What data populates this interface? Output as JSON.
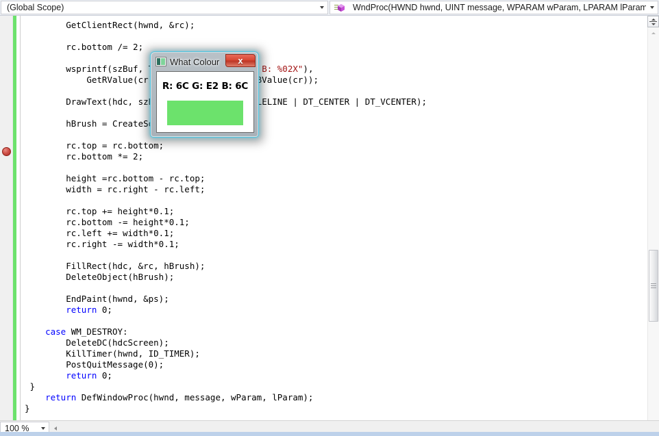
{
  "nav": {
    "scope": {
      "value": "(Global Scope)",
      "arrow_icon": "chevron-down-icon"
    },
    "member": {
      "value": "WndProc(HWND hwnd, UINT message, WPARAM wParam, LPARAM lParam)",
      "icon": "method-icon",
      "arrow_icon": "chevron-down-icon"
    }
  },
  "editor": {
    "gutter": {
      "breakpoint_icon": "breakpoint-icon",
      "change_bar_color": "#6ce26c"
    },
    "code_lines": [
      {
        "indent": 8,
        "tokens": [
          {
            "t": "GetClientRect(hwnd, &rc);",
            "c": "plain"
          }
        ]
      },
      {
        "indent": 0,
        "tokens": []
      },
      {
        "indent": 8,
        "tokens": [
          {
            "t": "rc.bottom /= 2;",
            "c": "plain"
          }
        ]
      },
      {
        "indent": 0,
        "tokens": []
      },
      {
        "indent": 8,
        "tokens": [
          {
            "t": "wsprintf(szBuf, TEXT(\"R: %02X G: %02X B: %02X\"),",
            "c": "mixed-string"
          }
        ]
      },
      {
        "indent": 12,
        "tokens": [
          {
            "t": "GetRValue(cr), GetGValue(cr), GetBValue(cr));",
            "c": "plain"
          }
        ]
      },
      {
        "indent": 0,
        "tokens": []
      },
      {
        "indent": 8,
        "tokens": [
          {
            "t": "DrawText(hdc, szBuf, -1, &rc, DT_SINGLELINE | DT_CENTER | DT_VCENTER);",
            "c": "plain"
          }
        ]
      },
      {
        "indent": 0,
        "tokens": []
      },
      {
        "indent": 8,
        "tokens": [
          {
            "t": "hBrush = CreateSolidBrush(cr);",
            "c": "plain"
          }
        ]
      },
      {
        "indent": 0,
        "tokens": []
      },
      {
        "indent": 8,
        "tokens": [
          {
            "t": "rc.top = rc.bottom;",
            "c": "plain"
          }
        ]
      },
      {
        "indent": 8,
        "tokens": [
          {
            "t": "rc.bottom *= 2;",
            "c": "plain"
          }
        ]
      },
      {
        "indent": 0,
        "tokens": []
      },
      {
        "indent": 8,
        "tokens": [
          {
            "t": "height =rc.bottom - rc.top;",
            "c": "plain"
          }
        ]
      },
      {
        "indent": 8,
        "tokens": [
          {
            "t": "width = rc.right - rc.left;",
            "c": "plain"
          }
        ]
      },
      {
        "indent": 0,
        "tokens": []
      },
      {
        "indent": 8,
        "tokens": [
          {
            "t": "rc.top += height*0.1;",
            "c": "plain"
          }
        ]
      },
      {
        "indent": 8,
        "tokens": [
          {
            "t": "rc.bottom -= height*0.1;",
            "c": "plain"
          }
        ]
      },
      {
        "indent": 8,
        "tokens": [
          {
            "t": "rc.left += width*0.1;",
            "c": "plain"
          }
        ]
      },
      {
        "indent": 8,
        "tokens": [
          {
            "t": "rc.right -= width*0.1;",
            "c": "plain"
          }
        ]
      },
      {
        "indent": 0,
        "tokens": []
      },
      {
        "indent": 8,
        "tokens": [
          {
            "t": "FillRect(hdc, &rc, hBrush);",
            "c": "plain"
          }
        ]
      },
      {
        "indent": 8,
        "tokens": [
          {
            "t": "DeleteObject(hBrush);",
            "c": "plain"
          }
        ]
      },
      {
        "indent": 0,
        "tokens": []
      },
      {
        "indent": 8,
        "tokens": [
          {
            "t": "EndPaint(hwnd, &ps);",
            "c": "plain"
          }
        ]
      },
      {
        "indent": 8,
        "tokens": [
          {
            "t": "return",
            "c": "kw"
          },
          {
            "t": " 0;",
            "c": "plain"
          }
        ]
      },
      {
        "indent": 0,
        "tokens": []
      },
      {
        "indent": 4,
        "tokens": [
          {
            "t": "case",
            "c": "kw"
          },
          {
            "t": " WM_DESTROY:",
            "c": "plain"
          }
        ]
      },
      {
        "indent": 8,
        "tokens": [
          {
            "t": "DeleteDC(hdcScreen);",
            "c": "plain"
          }
        ]
      },
      {
        "indent": 8,
        "tokens": [
          {
            "t": "KillTimer(hwnd, ID_TIMER);",
            "c": "plain"
          }
        ]
      },
      {
        "indent": 8,
        "tokens": [
          {
            "t": "PostQuitMessage(0);",
            "c": "plain"
          }
        ]
      },
      {
        "indent": 8,
        "tokens": [
          {
            "t": "return",
            "c": "kw"
          },
          {
            "t": " 0;",
            "c": "plain"
          }
        ]
      },
      {
        "indent": 1,
        "tokens": [
          {
            "t": "}",
            "c": "plain"
          }
        ]
      },
      {
        "indent": 4,
        "tokens": [
          {
            "t": "return",
            "c": "kw"
          },
          {
            "t": " DefWindowProc(hwnd, message, wParam, lParam);",
            "c": "plain"
          }
        ]
      },
      {
        "indent": 0,
        "tokens": [
          {
            "t": "}",
            "c": "plain"
          }
        ]
      }
    ],
    "overlapped_line_fragments": {
      "line5_right": "%02X B: %02X\"),",
      "line6_right": "tBValue(cr));",
      "line8_right": "_SINGLELINE | DT_CENTER | DT_VCENTER);",
      "line5_left": "wsprintf(szBuf",
      "line6_left": "GetRValue(",
      "line8_left": "DrawText(hdc,",
      "line10_left": "hBrush = Creat"
    },
    "colors": {
      "keyword": "#0000ff",
      "string": "#a31515",
      "plain": "#000000"
    },
    "scrollbar": {
      "split_icon": "split-view-icon",
      "up_arrow_icon": "chevron-up-icon",
      "thumb_grip_icon": "grip-icon"
    }
  },
  "dialog": {
    "title": "What Colour",
    "app_icon": "app-icon",
    "close_label": "x",
    "colour_text": "R: 6C G: E2 B: 6C",
    "swatch_color": "#6ce26c",
    "rgb": {
      "r": "6C",
      "g": "E2",
      "b": "6C"
    }
  },
  "bottom": {
    "zoom": "100 %",
    "zoom_arrow_icon": "chevron-down-icon",
    "hscroll_left_icon": "chevron-left-icon"
  }
}
